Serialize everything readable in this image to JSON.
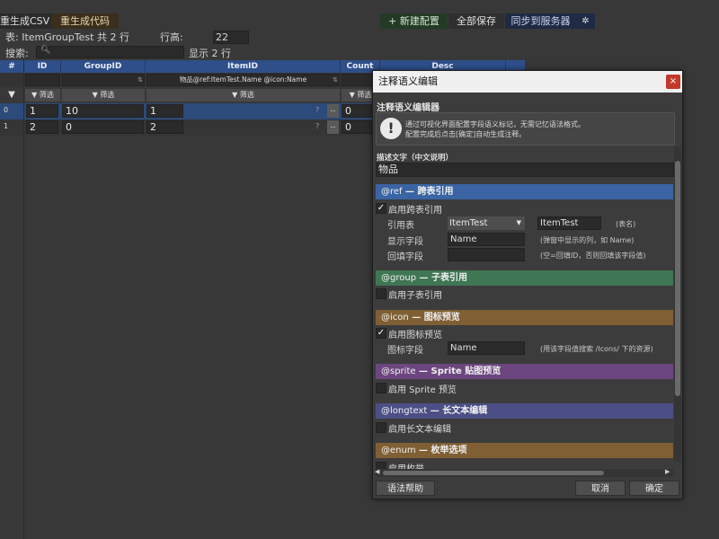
{
  "toolbar": {
    "regen_csv": "重生成CSV",
    "regen_code": "重生成代码",
    "new_config": "+ 新建配置",
    "save_all": "全部保存",
    "sync_server": "同步到服务器",
    "settings_glyph": "✲"
  },
  "info": {
    "table_label": "表: ItemGroupTest",
    "row_count": "共 2 行",
    "row_height_label": "行高:",
    "row_height_value": "22"
  },
  "search": {
    "label": "搜索:",
    "shown": "显示 2 行"
  },
  "grid": {
    "columns": [
      "#",
      "ID",
      "GroupID",
      "ItemID",
      "Count",
      "Desc"
    ],
    "itemid_meta": "物品@ref:ItemTest.Name @icon:Name",
    "sort_glyph": "⇅",
    "filter_label": "▼ 筛选",
    "filter_caret": "▼",
    "question": "?",
    "dots": "..",
    "rows": [
      {
        "idx": "0",
        "id": "1",
        "group": "10",
        "item": "1",
        "count": "0"
      },
      {
        "idx": "1",
        "id": "2",
        "group": "0",
        "item": "2",
        "count": "0"
      }
    ]
  },
  "modal": {
    "title": "注释语义编辑",
    "close": "×",
    "heading": "注释语义编辑器",
    "tip_icon": "!",
    "tip_line1": "通过可视化界面配置字段语义标记，无需记忆语法格式。",
    "tip_line2": "配置完成后点击[确定]自动生成注释。",
    "desc_label": "描述文字（中文说明）",
    "desc_value": "物品",
    "ref": {
      "tag": "@ref",
      "title": " — 跨表引用",
      "checked": "✓",
      "enable": "启用跨表引用",
      "table_label": "引用表",
      "table_value": "ItemTest",
      "table_name": "ItemTest",
      "table_hint": "(表名)",
      "display_label": "显示字段",
      "display_value": "Name",
      "display_hint": "(弹窗中显示的列，如 Name)",
      "fill_label": "回填字段",
      "fill_value": "",
      "fill_hint": "(空=回填ID，否则回填该字段值)"
    },
    "group": {
      "tag": "@group",
      "title": " — 子表引用",
      "enable": "启用子表引用"
    },
    "icon": {
      "tag": "@icon",
      "title": " — 图标预览",
      "checked": "✓",
      "enable": "启用图标预览",
      "field_label": "图标字段",
      "field_value": "Name",
      "field_hint": "(用该字段值搜索 /Icons/ 下的资源)"
    },
    "sprite": {
      "tag": "@sprite",
      "title": " — Sprite 贴图预览",
      "enable": "启用 Sprite 预览"
    },
    "longtext": {
      "tag": "@longtext",
      "title": " — 长文本编辑",
      "enable": "启用长文本编辑"
    },
    "enum": {
      "tag": "@enum",
      "title": " — 枚举选项",
      "enable": "启用枚举"
    },
    "help": "语法帮助",
    "cancel": "取消",
    "ok": "确定"
  },
  "colors": {
    "ref": "#3a64a3",
    "group": "#3f7653",
    "icon": "#7f5f33",
    "sprite": "#6c477f",
    "longtext": "#4c4f86",
    "enum": "#7f5f33"
  }
}
